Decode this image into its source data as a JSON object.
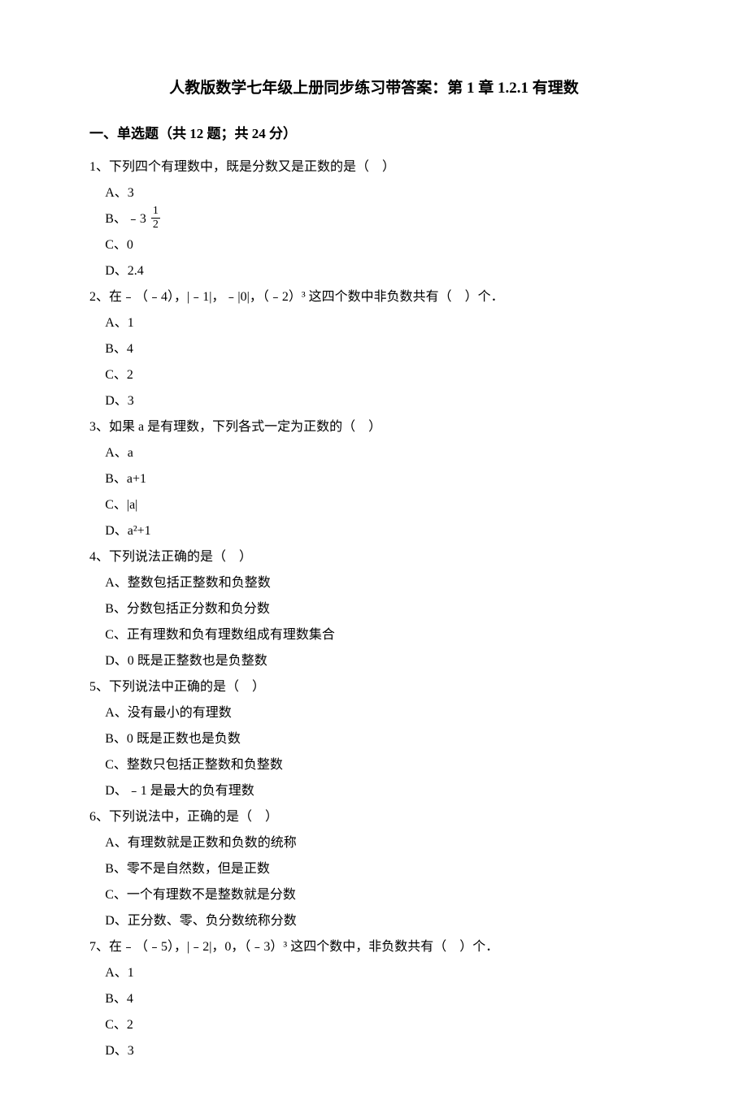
{
  "title": "人教版数学七年级上册同步练习带答案：第 1 章 1.2.1 有理数",
  "section_header": "一、单选题（共 12 题；共 24 分）",
  "questions": [
    {
      "stem": "1、下列四个有理数中，既是分数又是正数的是（　）",
      "options": [
        "A、3",
        "B、﹣3 ",
        "C、0",
        "D、2.4"
      ],
      "fraction_option_index": 1,
      "fraction_num": "1",
      "fraction_den": "2"
    },
    {
      "stem": "2、在﹣（﹣4），|﹣1|，﹣|0|，（﹣2）³ 这四个数中非负数共有（　）个．",
      "options": [
        "A、1",
        "B、4",
        "C、2",
        "D、3"
      ]
    },
    {
      "stem": "3、如果 a 是有理数，下列各式一定为正数的（　）",
      "options": [
        "A、a",
        "B、a+1",
        "C、|a|",
        "D、a²+1"
      ]
    },
    {
      "stem": "4、下列说法正确的是（　）",
      "options": [
        "A、整数包括正整数和负整数",
        "B、分数包括正分数和负分数",
        "C、正有理数和负有理数组成有理数集合",
        "D、0 既是正整数也是负整数"
      ]
    },
    {
      "stem": "5、下列说法中正确的是（　）",
      "options": [
        "A、没有最小的有理数",
        "B、0 既是正数也是负数",
        "C、整数只包括正整数和负整数",
        "D、﹣1 是最大的负有理数"
      ]
    },
    {
      "stem": "6、下列说法中，正确的是（　）",
      "options": [
        "A、有理数就是正数和负数的统称",
        "B、零不是自然数，但是正数",
        "C、一个有理数不是整数就是分数",
        "D、正分数、零、负分数统称分数"
      ]
    },
    {
      "stem": "7、在﹣（﹣5），|﹣2|，0，（﹣3）³ 这四个数中，非负数共有（　）个．",
      "options": [
        "A、1",
        "B、4",
        "C、2",
        "D、3"
      ]
    }
  ]
}
